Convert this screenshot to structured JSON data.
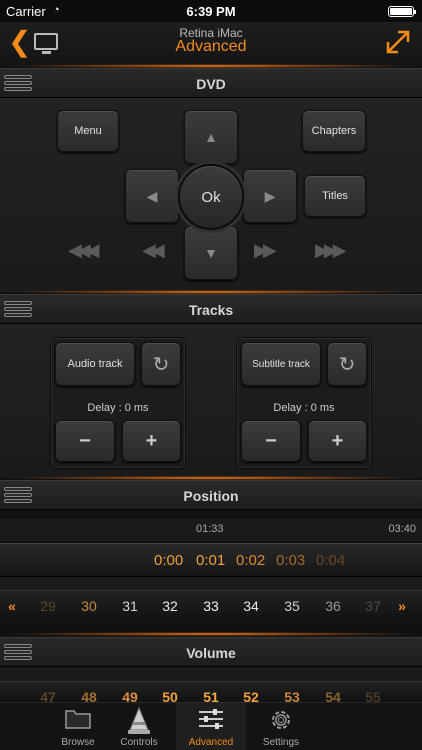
{
  "status_bar": {
    "carrier": "Carrier",
    "time": "6:39 PM"
  },
  "nav": {
    "subtitle": "Retina iMac",
    "title": "Advanced"
  },
  "sections": {
    "dvd": "DVD",
    "tracks": "Tracks",
    "position": "Position",
    "volume": "Volume"
  },
  "dvd": {
    "menu": "Menu",
    "chapters": "Chapters",
    "ok": "Ok",
    "titles": "Titles"
  },
  "tracks": {
    "audio_label": "Audio track",
    "subtitle_label": "Subtitle track",
    "audio_delay": "Delay : 0 ms",
    "subtitle_delay": "Delay : 0 ms",
    "minus": "−",
    "plus": "+"
  },
  "position": {
    "current_time": "01:33",
    "total_time": "03:40",
    "offsets": [
      "0:00",
      "0:01",
      "0:02",
      "0:03",
      "0:04"
    ],
    "chapters": [
      "29",
      "30",
      "31",
      "32",
      "33",
      "34",
      "35",
      "36",
      "37"
    ],
    "left_arrows": "«",
    "right_arrows": "»"
  },
  "volume": {
    "values": [
      "47",
      "48",
      "49",
      "50",
      "51",
      "52",
      "53",
      "54",
      "55"
    ]
  },
  "tabs": [
    {
      "label": "Browse",
      "icon": "folder-icon"
    },
    {
      "label": "Controls",
      "icon": "vlc-cone-icon"
    },
    {
      "label": "Advanced",
      "icon": "sliders-icon"
    },
    {
      "label": "Settings",
      "icon": "gear-icon"
    }
  ],
  "colors": {
    "accent": "#f38a1a",
    "orange_text": "#e8952e"
  }
}
